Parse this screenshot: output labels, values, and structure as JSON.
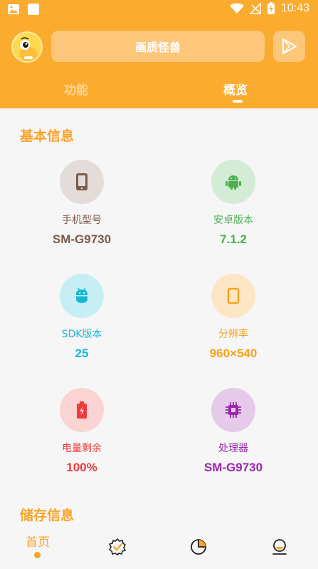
{
  "status_bar": {
    "time": "10:43"
  },
  "header": {
    "title": "画质怪兽",
    "tabs": [
      {
        "label": "功能",
        "active": false
      },
      {
        "label": "概览",
        "active": true
      }
    ]
  },
  "basic_info": {
    "title": "基本信息",
    "items": [
      {
        "label": "手机型号",
        "value": "SM-G9730",
        "icon": "phone-icon",
        "color": "#7b5a4a",
        "bg": "#e3dcd9"
      },
      {
        "label": "安卓版本",
        "value": "7.1.2",
        "icon": "android-icon",
        "color": "#4caf50",
        "bg": "#d4ecd5"
      },
      {
        "label": "SDK版本",
        "value": "25",
        "icon": "android-bot-icon",
        "color": "#17b8d6",
        "bg": "#c8eef5"
      },
      {
        "label": "分辨率",
        "value": "960×540",
        "icon": "screen-icon",
        "color": "#f7a21b",
        "bg": "#fde6c6"
      },
      {
        "label": "电量剩余",
        "value": "100%",
        "icon": "battery-icon",
        "color": "#ee3b3b",
        "bg": "#fbd3d3"
      },
      {
        "label": "处理器",
        "value": "SM-G9730",
        "icon": "cpu-icon",
        "color": "#9c27b0",
        "bg": "#e5cbe9"
      }
    ]
  },
  "storage_info": {
    "title": "储存信息"
  },
  "bottom_nav": {
    "home_label": "首页",
    "accent": "#f9a32a"
  }
}
